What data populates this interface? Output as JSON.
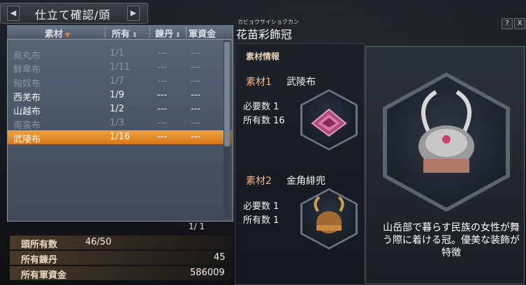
{
  "window": {
    "title": "仕立て確認/頭",
    "prev_arrow": "◀",
    "next_arrow": "▶",
    "help_label": "?",
    "close_label": "X"
  },
  "columns": {
    "material": "素材",
    "owned": "所有",
    "rentan": "錬丹",
    "funds": "軍資金"
  },
  "materials": [
    {
      "name": "烏丸布",
      "count": "1/1",
      "rentan": "---",
      "funds": "---",
      "state": "dim"
    },
    {
      "name": "鮮卑布",
      "count": "1/11",
      "rentan": "---",
      "funds": "---",
      "state": "dim"
    },
    {
      "name": "匈奴布",
      "count": "1/7",
      "rentan": "---",
      "funds": "---",
      "state": "dim"
    },
    {
      "name": "西羌布",
      "count": "1/9",
      "rentan": "---",
      "funds": "---",
      "state": "active"
    },
    {
      "name": "山越布",
      "count": "1/2",
      "rentan": "---",
      "funds": "---",
      "state": "active"
    },
    {
      "name": "南蛮布",
      "count": "1/3",
      "rentan": "---",
      "funds": "---",
      "state": "dim"
    },
    {
      "name": "武陵布",
      "count": "1/16",
      "rentan": "---",
      "funds": "---",
      "state": "sel"
    }
  ],
  "page": "1/ 1",
  "stats": {
    "head_owned_label": "頭所有数",
    "head_owned_value": "46/50",
    "rentan_label": "所有錬丹",
    "rentan_value": "45",
    "funds_label": "所有軍資金",
    "funds_value": "586009"
  },
  "item": {
    "furigana": "カビョウサイショクカン",
    "name": "花苗彩飾冠"
  },
  "info": {
    "header": "素材情報",
    "mat1_label": "素材1",
    "mat1_name": "武陵布",
    "mat1_required": "必要数 1",
    "mat1_owned": "所有数 16",
    "mat2_label": "素材2",
    "mat2_name": "金角緋兜",
    "mat2_required": "必要数 1",
    "mat2_owned": "所有数 1"
  },
  "description": "山岳部で暮らす民族の女性が舞う際に着ける冠。優美な装飾が特徴",
  "colors": {
    "selection": "#e88a2a",
    "accent_label": "#ffb070"
  }
}
